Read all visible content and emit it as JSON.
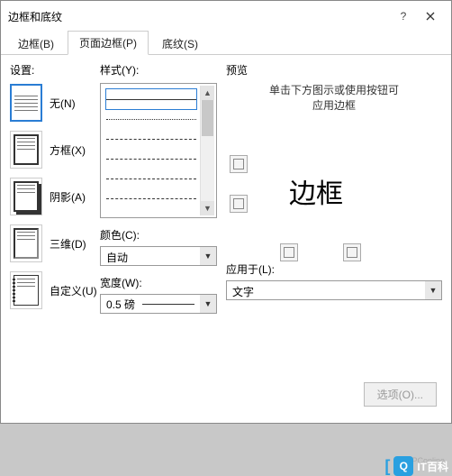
{
  "title": "边框和底纹",
  "tabs": [
    {
      "label": "边框(B)",
      "hotkey": "B",
      "active": false
    },
    {
      "label": "页面边框(P)",
      "hotkey": "P",
      "active": true
    },
    {
      "label": "底纹(S)",
      "hotkey": "S",
      "active": false
    }
  ],
  "settings": {
    "label": "设置:",
    "items": [
      {
        "label": "无(N)"
      },
      {
        "label": "方框(X)"
      },
      {
        "label": "阴影(A)"
      },
      {
        "label": "三维(D)"
      },
      {
        "label": "自定义(U)"
      }
    ]
  },
  "style": {
    "label": "样式(Y):",
    "color_label": "颜色(C):",
    "color_value": "自动",
    "width_label": "宽度(W):",
    "width_value": "0.5 磅"
  },
  "preview": {
    "label": "预览",
    "hint_line1": "单击下方图示或使用按钮可",
    "hint_line2": "应用边框",
    "sample": "边框"
  },
  "applyto": {
    "label": "应用于(L):",
    "value": "文字"
  },
  "options_btn": "选项(O)...",
  "watermark": {
    "brand": "IT百科",
    "sub": "PConline"
  }
}
